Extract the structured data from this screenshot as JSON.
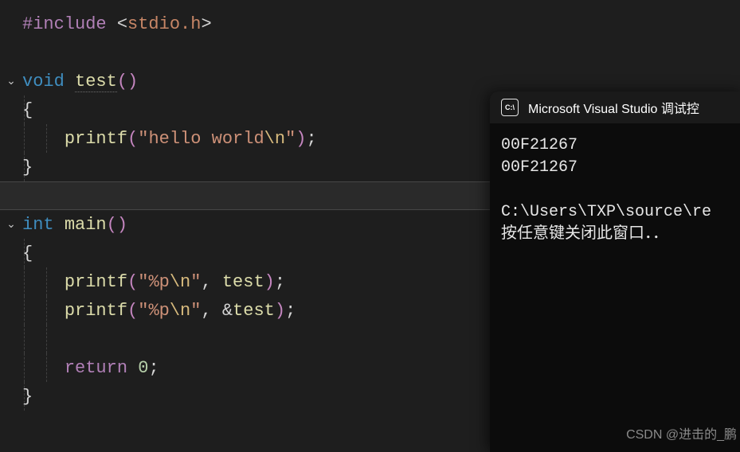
{
  "code": {
    "include_directive": "#include",
    "include_open": " <",
    "include_header": "stdio.h",
    "include_close": ">",
    "kw_void": "void",
    "kw_int": "int",
    "kw_return": "return",
    "fn_test": "test",
    "fn_main": "main",
    "fn_printf": "printf",
    "parens": "()",
    "lparen": "(",
    "rparen": ")",
    "lbrace": "{",
    "rbrace": "}",
    "semicolon": ";",
    "comma": ", ",
    "amp": "&",
    "str_q": "\"",
    "str_hello": "hello world",
    "str_pct_p": "%p",
    "str_esc_n": "\\n",
    "num_zero": "0",
    "space": " "
  },
  "console": {
    "title": "Microsoft Visual Studio 调试控",
    "icon_label": "C:\\",
    "lines": {
      "addr1": "00F21267",
      "addr2": "00F21267",
      "blank": "",
      "path": "C:\\Users\\TXP\\source\\re",
      "prompt": "按任意键关闭此窗口．．"
    }
  },
  "watermark": "CSDN @进击的_鹏"
}
